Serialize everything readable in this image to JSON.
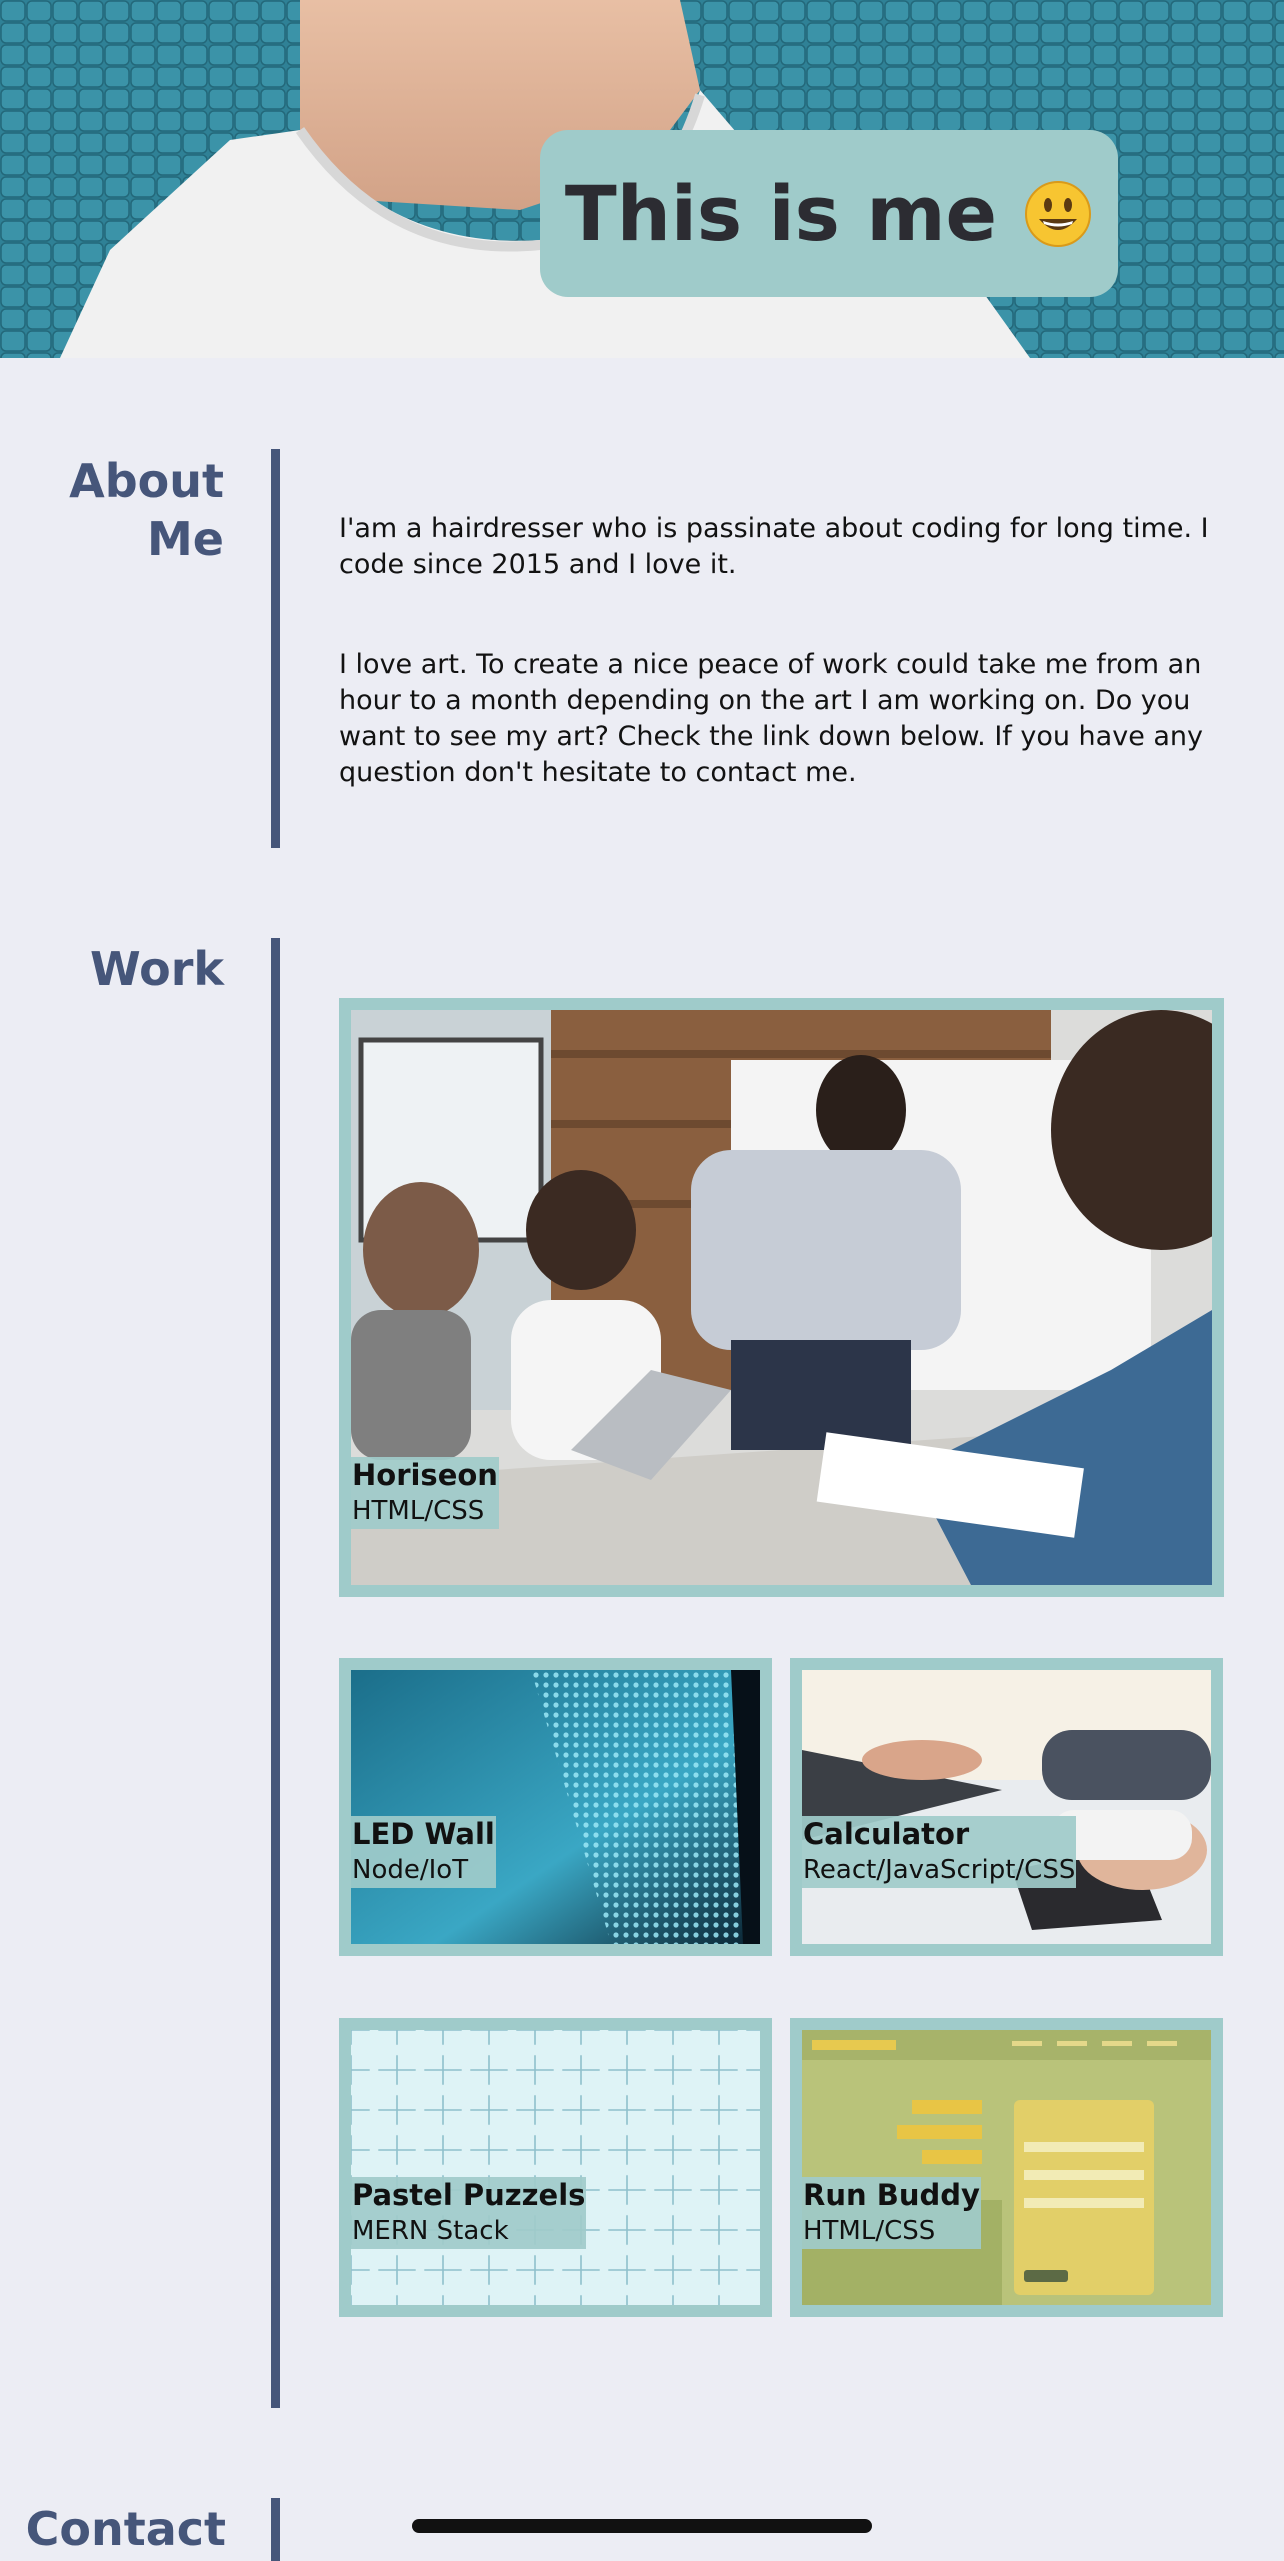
{
  "hero": {
    "title": "This is me",
    "emoji": "smiley-face-icon"
  },
  "about": {
    "title_line1": "About",
    "title_line2": "Me",
    "paragraphs": [
      "I'am a hairdresser who is passinate about coding for long time. I code since 2015 and I love it.",
      "I love art. To create a nice peace of work could take me from an hour to a month depending on the art I am working on. Do you want to see my art? Check the link down below. If you have any question don't hesitate to contact me."
    ]
  },
  "work": {
    "title": "Work",
    "projects": [
      {
        "name": "Horiseon",
        "tech": "HTML/CSS"
      },
      {
        "name": "LED Wall",
        "tech": "Node/IoT"
      },
      {
        "name": "Calculator",
        "tech": "React/JavaScript/CSS"
      },
      {
        "name": "Pastel Puzzels",
        "tech": "MERN Stack"
      },
      {
        "name": "Run Buddy",
        "tech": "HTML/CSS"
      }
    ]
  },
  "contact": {
    "title": "Contact"
  },
  "colors": {
    "background": "#ecedf4",
    "accent": "#9fcbca",
    "heading": "#46567a",
    "text": "#121212"
  }
}
